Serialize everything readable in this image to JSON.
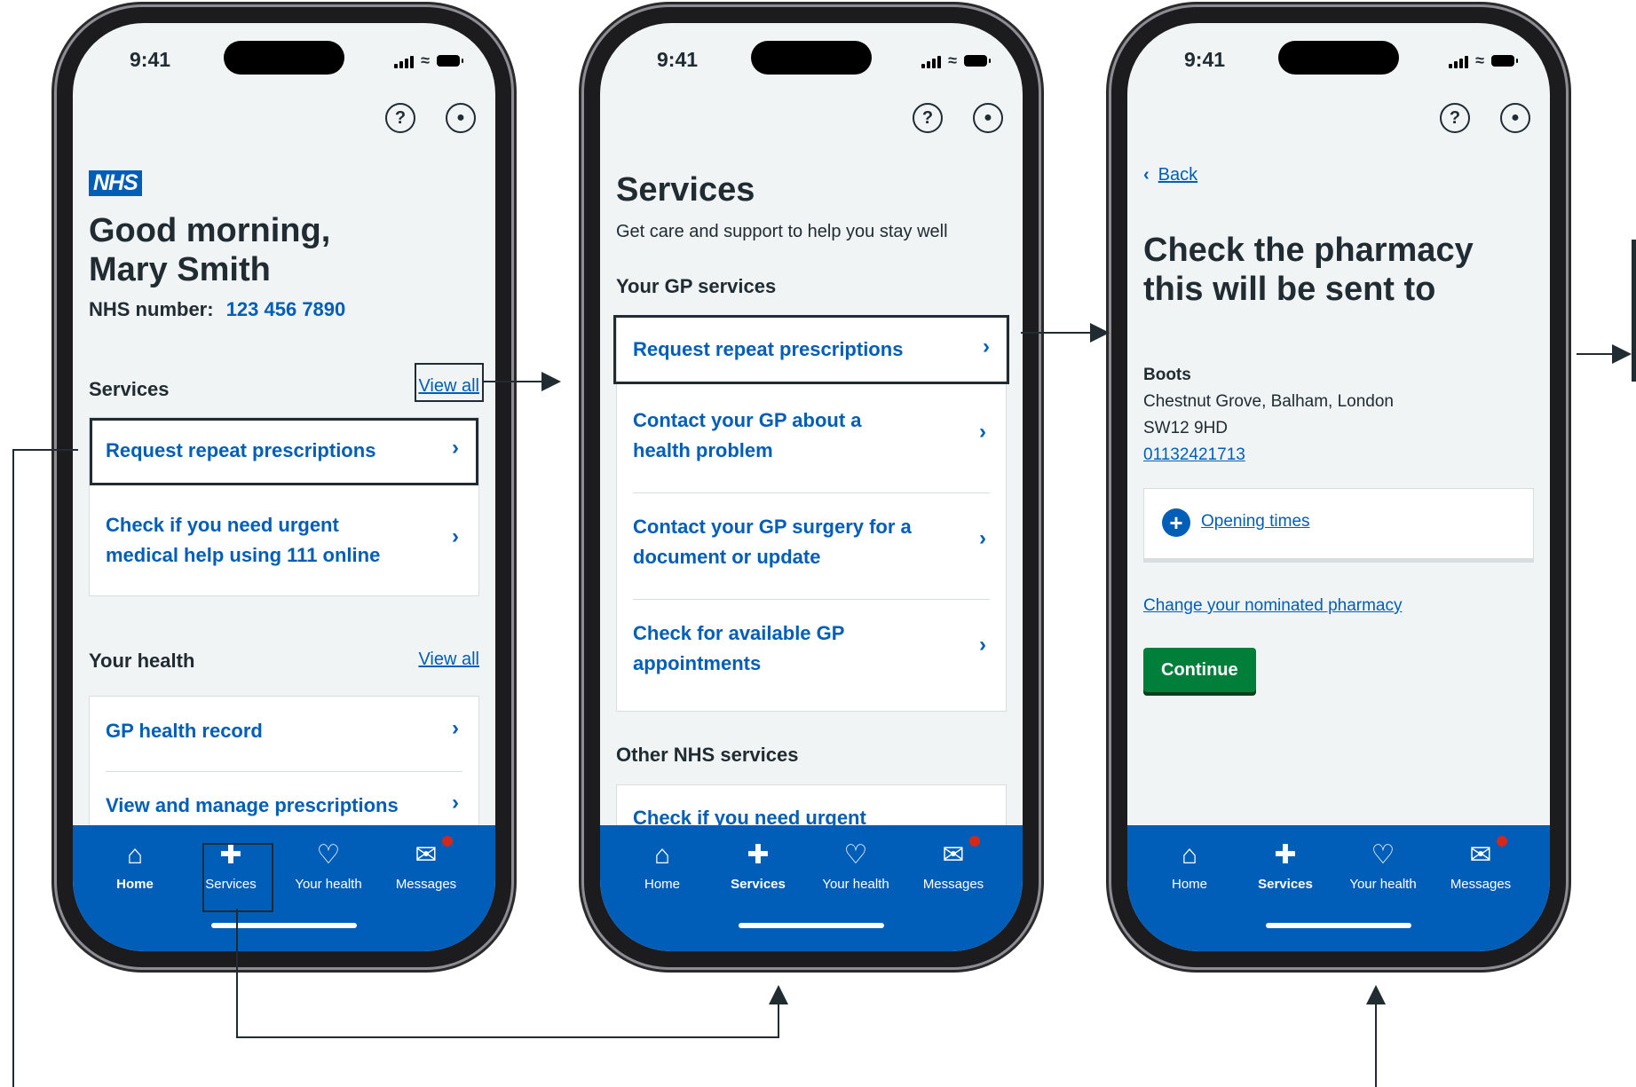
{
  "status": {
    "time": "9:41"
  },
  "tabs": [
    "Home",
    "Services",
    "Your health",
    "Messages"
  ],
  "screen1": {
    "logo": "NHS",
    "greeting_line1": "Good morning,",
    "greeting_line2": "Mary Smith",
    "nhs_number_label": "NHS number:",
    "nhs_number_value": "123 456 7890",
    "services_heading": "Services",
    "view_all": "View all",
    "services_items": [
      "Request repeat prescriptions",
      "Check if you need urgent medical help using 111 online"
    ],
    "health_heading": "Your health",
    "health_items": [
      "GP health record",
      "View and manage prescriptions"
    ],
    "active_tab": "Home"
  },
  "screen2": {
    "title": "Services",
    "subtitle": "Get care and support to help you stay well",
    "gp_heading": "Your GP services",
    "gp_items": [
      "Request repeat prescriptions",
      "Contact your GP about a health problem",
      "Contact your GP surgery for a document or update",
      "Check for available GP appointments"
    ],
    "other_heading": "Other NHS services",
    "other_items": [
      "Check if you need urgent"
    ],
    "active_tab": "Services"
  },
  "screen3": {
    "back": "Back",
    "title_line1": "Check the pharmacy",
    "title_line2": "this will be sent to",
    "pharmacy_name": "Boots",
    "address_line1": "Chestnut Grove, Balham, London",
    "address_line2": "SW12 9HD",
    "phone": "01132421713",
    "opening_times": "Opening times",
    "change_link": "Change your nominated pharmacy",
    "continue": "Continue",
    "active_tab": "Services"
  }
}
